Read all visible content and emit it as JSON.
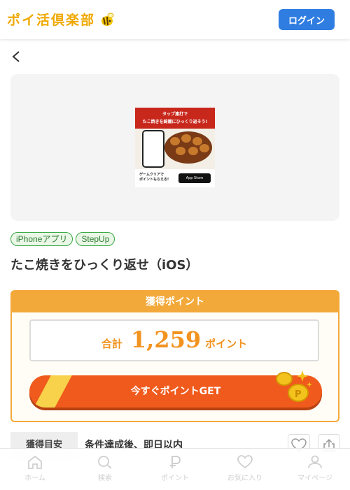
{
  "header": {
    "logo_text": "ポイ活倶楽部",
    "login_label": "ログイン"
  },
  "banner": {
    "top_line1": "タップ連打で",
    "top_line2": "たこ焼きを綺麗にひっくり返そう!",
    "bottom_line1": "ゲームクリアで",
    "bottom_line2": "ポイントもらえる!",
    "store_label": "App Store"
  },
  "tags": [
    "iPhoneアプリ",
    "StepUp"
  ],
  "title": "たこ焼きをひっくり返せ（iOS）",
  "points": {
    "header": "獲得ポイント",
    "total_label": "合計",
    "total_value": "1,259",
    "unit": "ポイント",
    "button_label": "今すぐポイントGET"
  },
  "timing": {
    "label": "獲得目安",
    "value": "条件達成後、即日以内"
  },
  "bottom_nav": [
    {
      "label": "ホーム",
      "icon": "home-icon"
    },
    {
      "label": "検索",
      "icon": "search-icon"
    },
    {
      "label": "ポイント",
      "icon": "point-icon"
    },
    {
      "label": "お気に入り",
      "icon": "heart-icon"
    },
    {
      "label": "マイページ",
      "icon": "user-icon"
    }
  ],
  "colors": {
    "brand": "#f0a800",
    "login": "#2f7de1",
    "points_orange": "#f3a93a",
    "cta": "#f05a1c",
    "tag_green": "#3aa844"
  }
}
